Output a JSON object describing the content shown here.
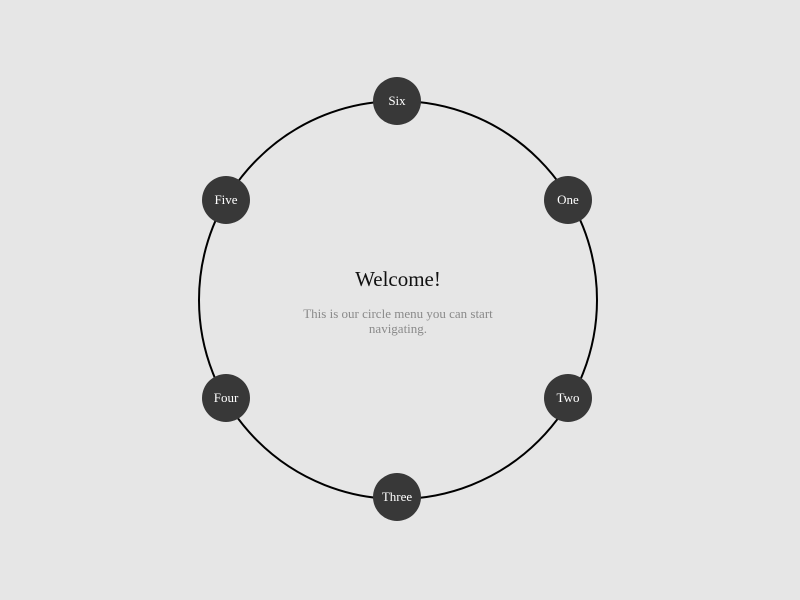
{
  "center": {
    "title": "Welcome!",
    "text": "This is our circle menu you can start navigating."
  },
  "menu": {
    "items": [
      {
        "label": "One"
      },
      {
        "label": "Two"
      },
      {
        "label": "Three"
      },
      {
        "label": "Four"
      },
      {
        "label": "Five"
      },
      {
        "label": "Six"
      }
    ]
  },
  "colors": {
    "background": "#e6e6e6",
    "ring": "#000000",
    "item_fill": "#383838",
    "item_text": "#ffffff",
    "subtitle": "#8a8a8a"
  }
}
